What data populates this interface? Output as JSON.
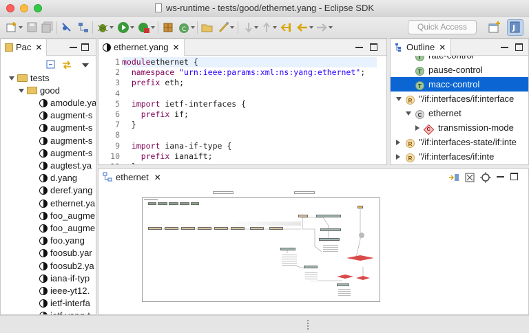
{
  "window": {
    "title": "ws-runtime - tests/good/ethernet.yang - Eclipse SDK"
  },
  "toolbar": {
    "quick_access_placeholder": "Quick Access"
  },
  "package_explorer": {
    "tab_label": "Pac",
    "tree": {
      "root": "tests",
      "folder": "good",
      "files": [
        "amodule.ya",
        "augment-s",
        "augment-s",
        "augment-s",
        "augment-s",
        "augtest.ya",
        "d.yang",
        "deref.yang",
        "ethernet.ya",
        "foo_augme",
        "foo_augme",
        "foo.yang",
        "foosub.yar",
        "foosub2.ya",
        "iana-if-typ",
        "ieee-yt12.",
        "ietf-interfa",
        "ietf-yang-t"
      ]
    }
  },
  "editor": {
    "tab_label": "ethernet.yang",
    "lines": [
      {
        "n": "1",
        "parts": [
          [
            "kw",
            "module"
          ],
          [
            "",
            "ethernet {"
          ]
        ]
      },
      {
        "n": "2",
        "parts": [
          [
            "",
            "  "
          ],
          [
            "kw",
            "namespace"
          ],
          [
            "",
            " "
          ],
          [
            "str",
            "\"urn:ieee:params:xml:ns:yang:ethernet\""
          ],
          [
            "",
            ";"
          ]
        ]
      },
      {
        "n": "3",
        "parts": [
          [
            "",
            "  "
          ],
          [
            "kw",
            "prefix"
          ],
          [
            "",
            " eth;"
          ]
        ]
      },
      {
        "n": "4",
        "parts": [
          [
            "",
            ""
          ]
        ]
      },
      {
        "n": "5",
        "parts": [
          [
            "",
            "  "
          ],
          [
            "kw",
            "import"
          ],
          [
            "",
            " ietf-interfaces {"
          ]
        ]
      },
      {
        "n": "6",
        "parts": [
          [
            "",
            "    "
          ],
          [
            "kw",
            "prefix"
          ],
          [
            "",
            " if;"
          ]
        ]
      },
      {
        "n": "7",
        "parts": [
          [
            "",
            "  }"
          ]
        ]
      },
      {
        "n": "8",
        "parts": [
          [
            "",
            ""
          ]
        ]
      },
      {
        "n": "9",
        "parts": [
          [
            "",
            "  "
          ],
          [
            "kw",
            "import"
          ],
          [
            "",
            " iana-if-type {"
          ]
        ]
      },
      {
        "n": "10",
        "parts": [
          [
            "",
            "    "
          ],
          [
            "kw",
            "prefix"
          ],
          [
            "",
            " ianaift;"
          ]
        ]
      },
      {
        "n": "11",
        "parts": [
          [
            "",
            "  }"
          ]
        ]
      }
    ]
  },
  "outline": {
    "tab_label": "Outline",
    "items": [
      {
        "label": "rate-control",
        "badge": "T",
        "indent": 1,
        "twisty": "",
        "selected": false
      },
      {
        "label": "pause-control",
        "badge": "T",
        "indent": 1,
        "twisty": "",
        "selected": false
      },
      {
        "label": "macc-control",
        "badge": "T",
        "indent": 1,
        "twisty": "",
        "selected": true
      },
      {
        "label": "\"/if:interfaces/if:interface",
        "badge": "R",
        "indent": 0,
        "twisty": "open",
        "selected": false
      },
      {
        "label": "ethernet",
        "badge": "C",
        "indent": 1,
        "twisty": "open",
        "selected": false
      },
      {
        "label": "transmission-mode",
        "badge": "ch",
        "indent": 2,
        "twisty": "closed",
        "selected": false
      },
      {
        "label": "\"/if:interfaces-state/if:inte",
        "badge": "R",
        "indent": 0,
        "twisty": "closed",
        "selected": false
      },
      {
        "label": "\"/if:interfaces/if:inte",
        "badge": "R",
        "indent": 0,
        "twisty": "closed",
        "selected": false
      }
    ]
  },
  "diagram": {
    "tab_label": "ethernet"
  },
  "colors": {
    "selection": "#0b66d4",
    "keyword": "#7f0055",
    "string": "#2a00ff"
  }
}
